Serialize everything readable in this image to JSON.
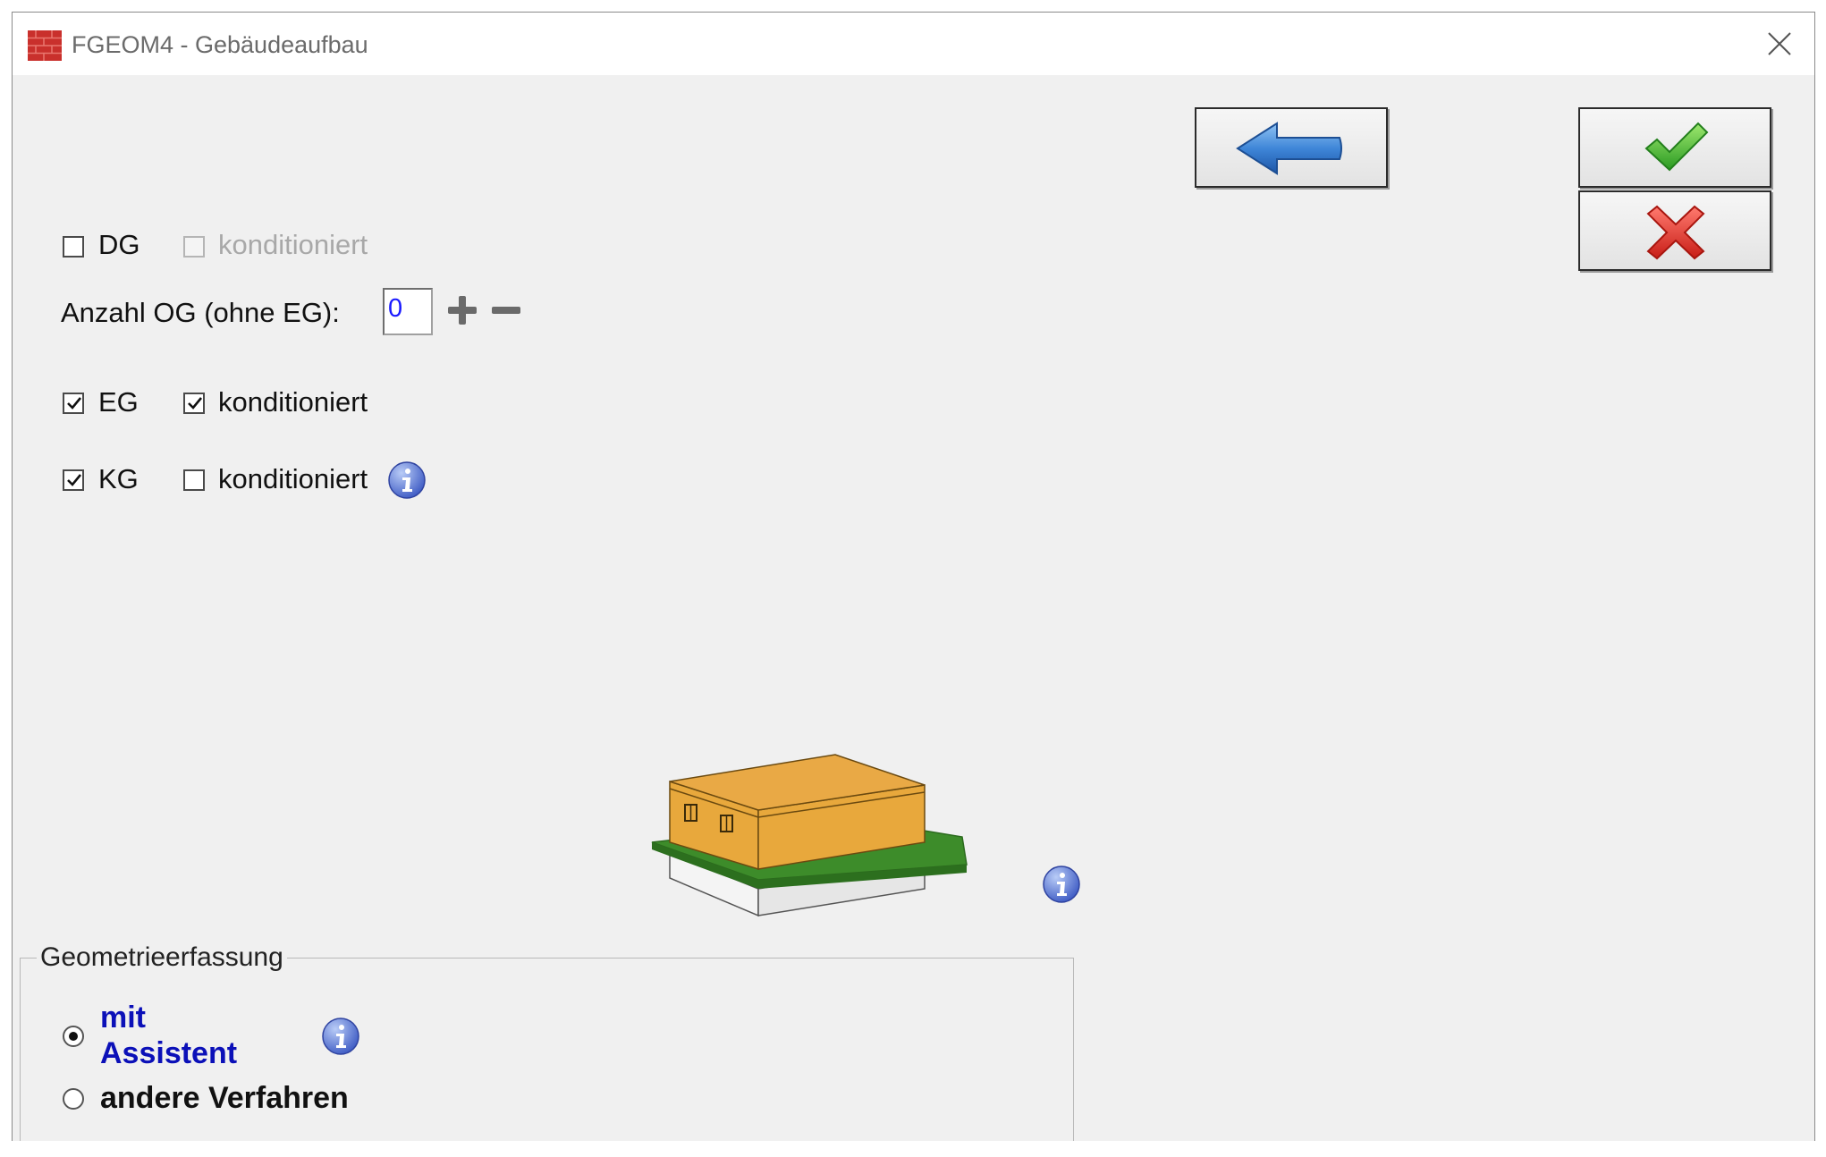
{
  "window": {
    "title": "FGEOM4 - Gebäudeaufbau"
  },
  "toolbar": {
    "back_icon": "arrow-left-icon",
    "ok_icon": "checkmark-icon",
    "cancel_icon": "red-x-icon"
  },
  "floors": {
    "dg": {
      "label": "DG",
      "checked": false,
      "konditioniert_label": "konditioniert",
      "konditioniert_checked": false,
      "konditioniert_enabled": false
    },
    "og_count": {
      "label": "Anzahl OG (ohne EG):",
      "value": "0",
      "plus_icon": "plus-icon",
      "minus_icon": "minus-icon"
    },
    "eg": {
      "label": "EG",
      "checked": true,
      "konditioniert_label": "konditioniert",
      "konditioniert_checked": true
    },
    "kg": {
      "label": "KG",
      "checked": true,
      "konditioniert_label": "konditioniert",
      "konditioniert_checked": false
    }
  },
  "geometry": {
    "legend": "Geometrieerfassung",
    "options": [
      {
        "label_line1": "mit",
        "label_line2": "Assistent",
        "selected": true
      },
      {
        "label": "andere Verfahren",
        "selected": false
      }
    ]
  },
  "colors": {
    "roof": "#e8a83c",
    "ground": "#3d8c2a",
    "arrow_blue": "#3f86d8",
    "check_green": "#3cb431",
    "cancel_red": "#e0322b",
    "selected_text": "#0b10b8"
  }
}
